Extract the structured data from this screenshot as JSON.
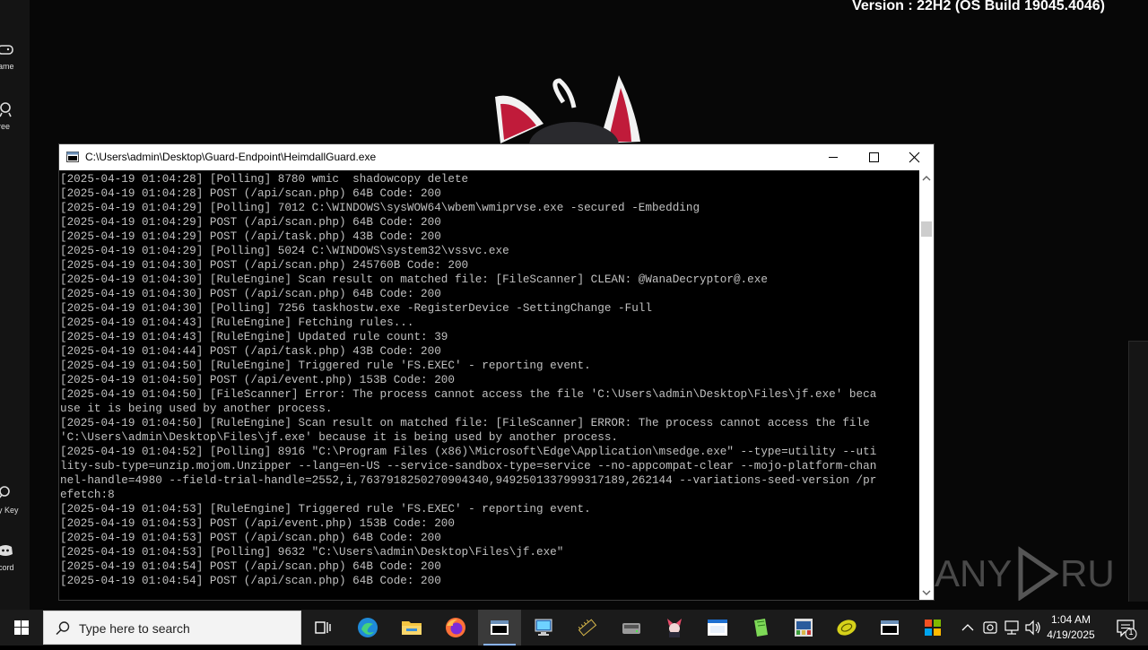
{
  "desktop": {
    "version_text": "Version : 22H2 (OS Build 19045.4046)",
    "watermark_text": "ANY RUN",
    "side_items": [
      {
        "label": "ame",
        "icon": "gamepad-icon"
      },
      {
        "label": "ree",
        "icon": "gift-icon"
      },
      {
        "label": "y Key",
        "icon": "key-icon"
      },
      {
        "label": "cord",
        "icon": "discord-icon"
      }
    ]
  },
  "window": {
    "title": "C:\\Users\\admin\\Desktop\\Guard-Endpoint\\HeimdallGuard.exe",
    "lines": [
      "[2025-04-19 01:04:28] [Polling] 8780 wmic  shadowcopy delete",
      "[2025-04-19 01:04:28] POST (/api/scan.php) 64B Code: 200",
      "[2025-04-19 01:04:29] [Polling] 7012 C:\\WINDOWS\\sysWOW64\\wbem\\wmiprvse.exe -secured -Embedding",
      "[2025-04-19 01:04:29] POST (/api/scan.php) 64B Code: 200",
      "[2025-04-19 01:04:29] POST (/api/task.php) 43B Code: 200",
      "[2025-04-19 01:04:29] [Polling] 5024 C:\\WINDOWS\\system32\\vssvc.exe",
      "[2025-04-19 01:04:30] POST (/api/scan.php) 245760B Code: 200",
      "[2025-04-19 01:04:30] [RuleEngine] Scan result on matched file: [FileScanner] CLEAN: @WanaDecryptor@.exe",
      "[2025-04-19 01:04:30] POST (/api/scan.php) 64B Code: 200",
      "[2025-04-19 01:04:30] [Polling] 7256 taskhostw.exe -RegisterDevice -SettingChange -Full",
      "[2025-04-19 01:04:43] [RuleEngine] Fetching rules...",
      "[2025-04-19 01:04:43] [RuleEngine] Updated rule count: 39",
      "[2025-04-19 01:04:44] POST (/api/task.php) 43B Code: 200",
      "[2025-04-19 01:04:50] [RuleEngine] Triggered rule 'FS.EXEC' - reporting event.",
      "[2025-04-19 01:04:50] POST (/api/event.php) 153B Code: 200",
      "[2025-04-19 01:04:50] [FileScanner] Error: The process cannot access the file 'C:\\Users\\admin\\Desktop\\Files\\jf.exe' beca",
      "use it is being used by another process.",
      "[2025-04-19 01:04:50] [RuleEngine] Scan result on matched file: [FileScanner] ERROR: The process cannot access the file",
      "'C:\\Users\\admin\\Desktop\\Files\\jf.exe' because it is being used by another process.",
      "[2025-04-19 01:04:52] [Polling] 8916 \"C:\\Program Files (x86)\\Microsoft\\Edge\\Application\\msedge.exe\" --type=utility --uti",
      "lity-sub-type=unzip.mojom.Unzipper --lang=en-US --service-sandbox-type=service --no-appcompat-clear --mojo-platform-chan",
      "nel-handle=4980 --field-trial-handle=2552,i,7637918250270904340,9492501337999317189,262144 --variations-seed-version /pr",
      "efetch:8",
      "[2025-04-19 01:04:53] [RuleEngine] Triggered rule 'FS.EXEC' - reporting event.",
      "[2025-04-19 01:04:53] POST (/api/event.php) 153B Code: 200",
      "[2025-04-19 01:04:53] POST (/api/scan.php) 64B Code: 200",
      "[2025-04-19 01:04:53] [Polling] 9632 \"C:\\Users\\admin\\Desktop\\Files\\jf.exe\"",
      "[2025-04-19 01:04:54] POST (/api/scan.php) 64B Code: 200",
      "[2025-04-19 01:04:54] POST (/api/scan.php) 64B Code: 200"
    ]
  },
  "taskbar": {
    "search_placeholder": "Type here to search",
    "time": "1:04 AM",
    "date": "4/19/2025",
    "notification_count": "1",
    "apps": [
      "task-view-icon",
      "edge-icon",
      "file-explorer-icon",
      "firefox-icon",
      "console-app-icon",
      "remote-desktop-icon",
      "chip-tool-icon",
      "disk-tool-icon",
      "anime-app-icon",
      "window-app-icon",
      "notepad-app-icon",
      "network-app-icon",
      "lemon-app-icon",
      "console-app-2-icon",
      "store-app-icon"
    ],
    "tray": [
      "chevron-up-icon",
      "webcam-icon",
      "network-icon",
      "volume-icon"
    ]
  }
}
